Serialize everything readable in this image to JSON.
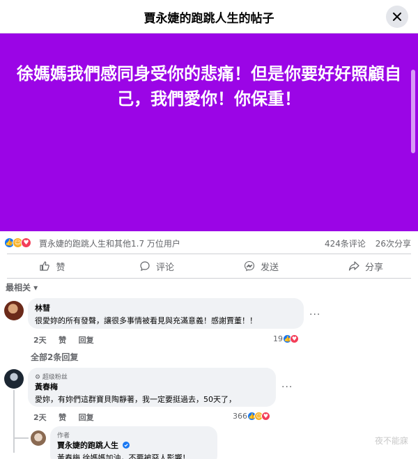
{
  "header": {
    "title": "賈永婕的跑跳人生的帖子"
  },
  "post": {
    "text": "徐媽媽我們感同身受你的悲痛！但是你要好好照顧自己，我們愛你！你保重！"
  },
  "stats": {
    "reactors": "賈永婕的跑跳人生和其他1.7 万位用户",
    "comments": "424条评论",
    "shares": "26次分享"
  },
  "actions": {
    "like": "赞",
    "comment": "评论",
    "send": "发送",
    "share": "分享"
  },
  "sort": "最相关 ▾",
  "comments": [
    {
      "author": "林彗",
      "text": "很愛妳的所有發聲，讓很多事情被看見與充滿意義！感謝賈董！！",
      "time": "2天",
      "like": "赞",
      "reply": "回复",
      "reactions": "19"
    },
    {
      "badge": "⚙ 超级粉丝",
      "author": "黃春梅",
      "text": "愛妳，有妳們這群寶貝陶靜著，我一定要挺過去，50天了，",
      "time": "2天",
      "like": "赞",
      "reply": "回复",
      "reactions": "366"
    },
    {
      "badge": "作者",
      "author": "賈永婕的跑跳人生",
      "text": "黃春梅 徐媽媽加油，不要被惡人影響！"
    }
  ],
  "view_replies": "全部2条回复",
  "watermark": "夜不能寐"
}
